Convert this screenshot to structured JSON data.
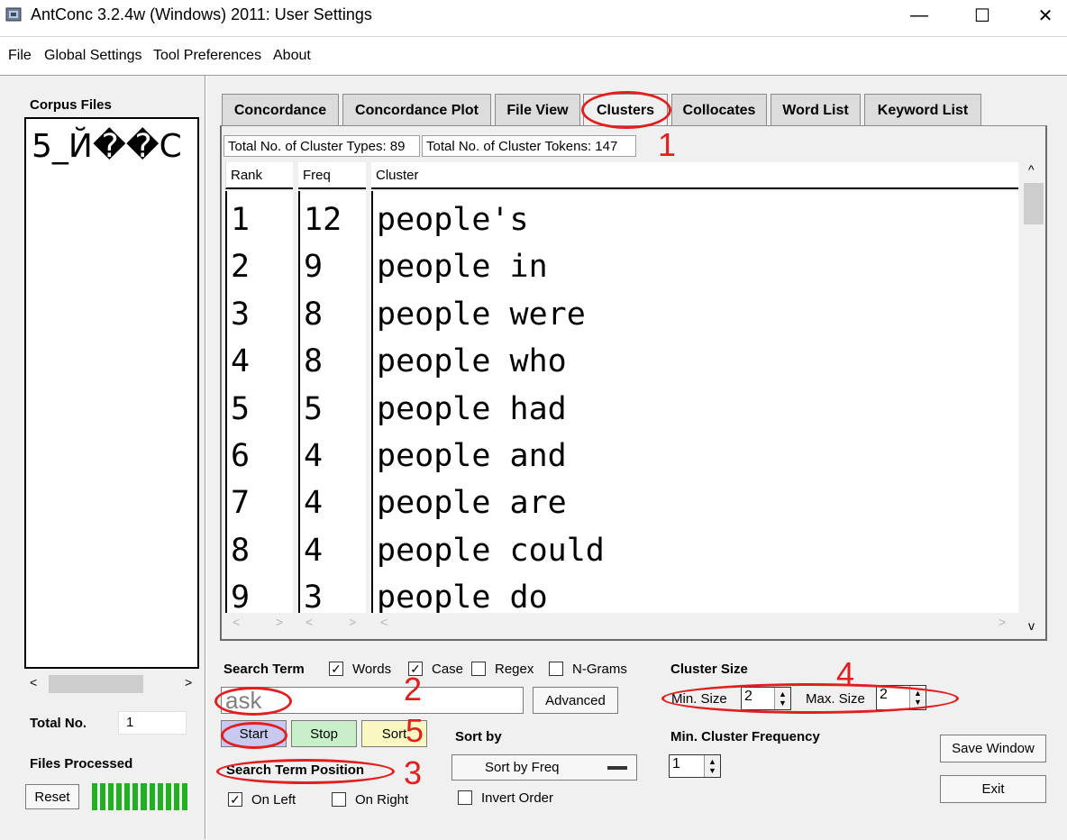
{
  "window": {
    "title": "AntConc 3.2.4w (Windows) 2011: User Settings",
    "minimize_glyph": "—",
    "maximize_glyph": "☐",
    "close_glyph": "✕"
  },
  "menu": [
    "File",
    "Global Settings",
    "Tool Preferences",
    "About"
  ],
  "left_panel": {
    "corpus_files_label": "Corpus Files",
    "corpus_file_name": "5_Й��С",
    "total_no_label": "Total No.",
    "total_no_value": "1",
    "files_processed_label": "Files Processed",
    "reset_label": "Reset",
    "progress_fraction": 1.0
  },
  "tabs": [
    "Concordance",
    "Concordance Plot",
    "File View",
    "Clusters",
    "Collocates",
    "Word List",
    "Keyword List"
  ],
  "active_tab": "Clusters",
  "stats": {
    "types": "Total No. of Cluster Types: 89",
    "tokens": "Total No. of Cluster Tokens: 147"
  },
  "table": {
    "headers": [
      "Rank",
      "Freq",
      "Cluster"
    ],
    "rows": [
      {
        "rank": "1",
        "freq": "12",
        "cluster": "people's"
      },
      {
        "rank": "2",
        "freq": "9",
        "cluster": "people in"
      },
      {
        "rank": "3",
        "freq": "8",
        "cluster": "people were"
      },
      {
        "rank": "4",
        "freq": "8",
        "cluster": "people who"
      },
      {
        "rank": "5",
        "freq": "5",
        "cluster": "people had"
      },
      {
        "rank": "6",
        "freq": "4",
        "cluster": "people and"
      },
      {
        "rank": "7",
        "freq": "4",
        "cluster": "people are"
      },
      {
        "rank": "8",
        "freq": "4",
        "cluster": "people could"
      },
      {
        "rank": "9",
        "freq": "3",
        "cluster": "people do"
      }
    ]
  },
  "search": {
    "search_term_label": "Search Term",
    "options": [
      {
        "label": "Words",
        "checked": true
      },
      {
        "label": "Case",
        "checked": true
      },
      {
        "label": "Regex",
        "checked": false
      },
      {
        "label": "N-Grams",
        "checked": false
      }
    ],
    "term_value": "ask",
    "advanced_label": "Advanced",
    "start_label": "Start",
    "stop_label": "Stop",
    "sort_label": "Sort",
    "position_label": "Search Term Position",
    "on_left_label": "On Left",
    "on_left_checked": true,
    "on_right_label": "On Right",
    "on_right_checked": false
  },
  "sort_by": {
    "label": "Sort by",
    "value": "Sort by Freq",
    "invert_label": "Invert Order",
    "invert_checked": false
  },
  "cluster_size": {
    "label": "Cluster Size",
    "min_label": "Min. Size",
    "min_value": "2",
    "max_label": "Max. Size",
    "max_value": "2",
    "min_freq_label": "Min. Cluster Frequency",
    "min_freq_value": "1"
  },
  "buttons": {
    "save_window": "Save Window",
    "exit": "Exit"
  },
  "annotations": [
    "1",
    "2",
    "3",
    "4",
    "5"
  ],
  "colors": {
    "annotation_red": "#e02020",
    "progress_green": "#22b022",
    "start_bg": "#c8c8f0",
    "stop_bg": "#c8f0c8",
    "sort_bg": "#f8f8c0"
  }
}
